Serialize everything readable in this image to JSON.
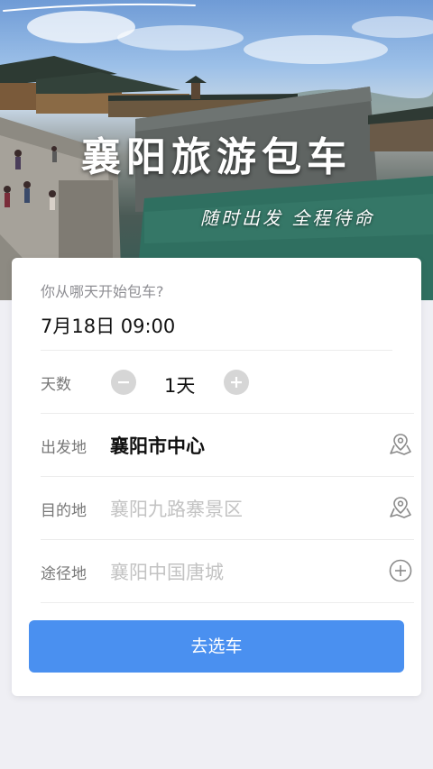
{
  "hero": {
    "title": "襄阳旅游包车",
    "slogan": "随时出发 全程待命"
  },
  "booking": {
    "date_prompt": "你从哪天开始包车?",
    "date_value": "7月18日 09:00",
    "days": {
      "label": "天数",
      "value": "1天",
      "decrement_icon": "minus-circle-icon",
      "increment_icon": "plus-circle-icon"
    },
    "departure": {
      "label": "出发地",
      "value": "襄阳市中心",
      "icon": "map-pin-icon"
    },
    "destination": {
      "label": "目的地",
      "placeholder": "襄阳九路寨景区",
      "icon": "map-pin-icon"
    },
    "waypoint": {
      "label": "途径地",
      "placeholder": "襄阳中国唐城",
      "icon": "plus-circle-icon"
    },
    "submit_label": "去选车"
  },
  "colors": {
    "accent": "#4a90f0",
    "background": "#efeff4"
  }
}
